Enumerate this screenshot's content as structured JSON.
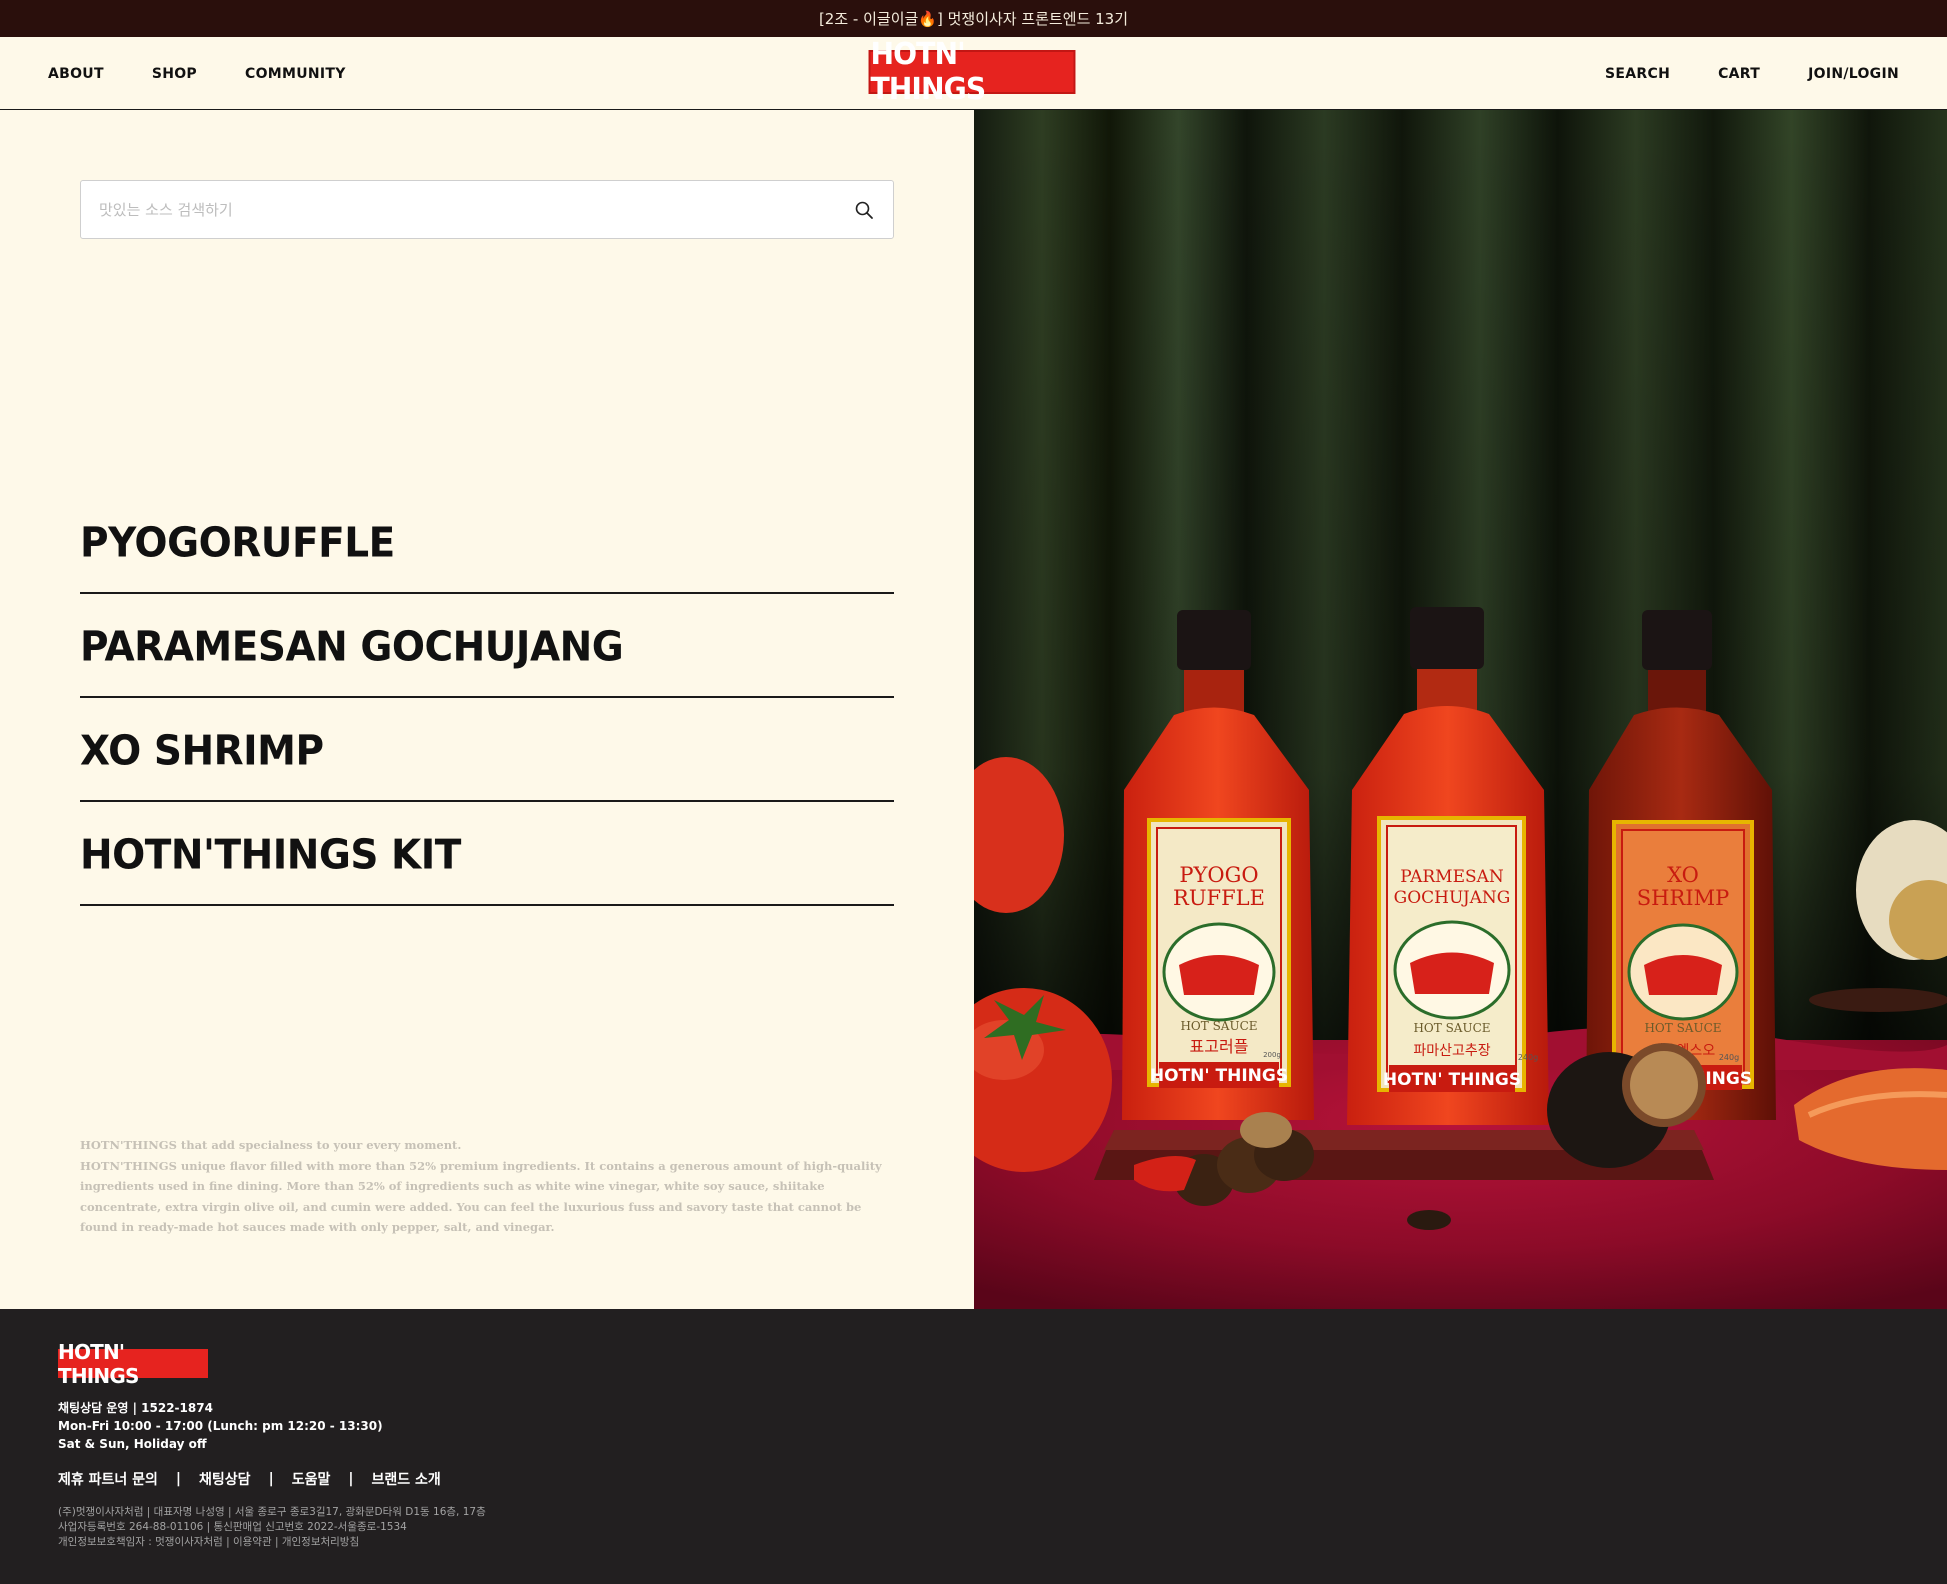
{
  "topbar": {
    "text": "[2조 - 이글이글🔥] 멋쟁이사자 프론트엔드 13기"
  },
  "header": {
    "nav_left": [
      "ABOUT",
      "SHOP",
      "COMMUNITY"
    ],
    "logo": "HOTN' THINGS",
    "nav_right": [
      "SEARCH",
      "CART",
      "JOIN/LOGIN"
    ]
  },
  "search": {
    "placeholder": "맛있는 소스 검색하기",
    "value": ""
  },
  "menu": [
    "PYOGORUFFLE",
    "PARAMESAN GOCHUJANG",
    "XO SHRIMP",
    "HOTN'THINGS KIT"
  ],
  "description": {
    "line1": "HOTN'THINGS that add specialness to your every moment.",
    "line2": "HOTN'THINGS unique flavor filled with more than 52% premium ingredients. It contains a generous amount of high-quality ingredients used in fine dining. More than 52% of ingredients such as white wine vinegar, white soy sauce, shiitake concentrate, extra virgin olive oil, and cumin were added. You can feel the luxurious fuss and savory taste that cannot be found in ready-made hot sauces made with only pepper, salt, and vinegar."
  },
  "hero": {
    "bottle1": {
      "name_line1": "PYOGO",
      "name_line2": "RUFFLE",
      "korean": "표고러플",
      "weight": "200g",
      "brand": "HOTN' THINGS",
      "badge": "HOT SAUCE"
    },
    "bottle2": {
      "name_line1": "PARMESAN",
      "name_line2": "GOCHUJANG",
      "korean": "파마산고추장",
      "weight": "240g",
      "brand": "HOTN' THINGS",
      "badge": "HOT SAUCE"
    },
    "bottle3": {
      "name_line1": "XO",
      "name_line2": "SHRIMP",
      "korean": "새우엑스오",
      "weight": "240g",
      "brand": "HOTN' THINGS",
      "badge": "HOT SAUCE"
    }
  },
  "footer": {
    "logo": "HOTN' THINGS",
    "contact_line1": "채팅상담 운영  |  1522-1874",
    "contact_line2": "Mon-Fri 10:00 - 17:00 (Lunch: pm 12:20 - 13:30)",
    "contact_line3": "Sat & Sun, Holiday off",
    "links": [
      "제휴 파트너 문의",
      "채팅상담",
      "도움말",
      "브랜드 소개"
    ],
    "legal_line1": "(주)멋쟁이사자처럼  |  대표자명 나성영  |  서울 종로구 종로3길17, 광화문D타워 D1동 16층, 17층",
    "legal_line2": "사업자등록번호 264-88-01106 | 통신판매업 신고번호 2022-서울종로-1534",
    "legal_line3": "개인정보보호책임자 : 멋쟁이사자처럼  |  이용약관  |  개인정보처리방침"
  },
  "colors": {
    "brand_red": "#e6231f",
    "cream": "#fef9e9",
    "footer_bg": "#221f20",
    "topbar_bg": "#2a0f0c"
  }
}
